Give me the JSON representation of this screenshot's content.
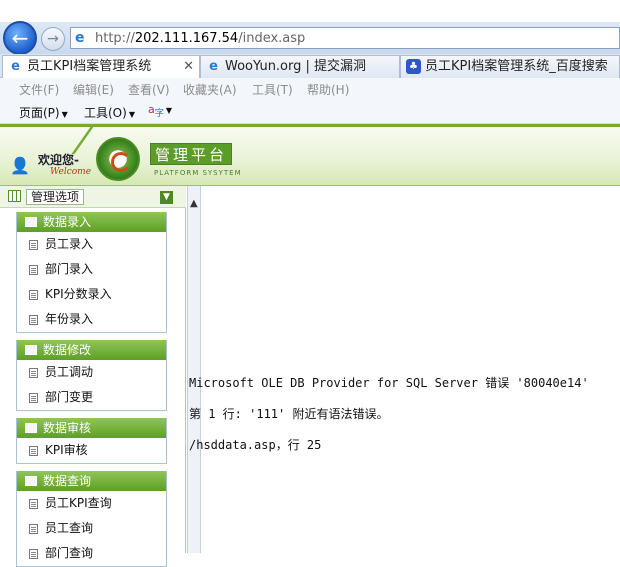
{
  "browser": {
    "url_prefix": "http://",
    "url_host": "202.111.167.54",
    "url_path": "/index.asp",
    "tabs": [
      {
        "label": "员工KPI档案管理系统",
        "active": true,
        "icon": "ie-icon"
      },
      {
        "label": "WooYun.org | 提交漏洞",
        "active": false,
        "icon": "ie-icon"
      },
      {
        "label": "员工KPI档案管理系统_百度搜索",
        "active": false,
        "icon": "baidu-paw-icon"
      }
    ],
    "menu": [
      "文件(F)",
      "编辑(E)",
      "查看(V)",
      "收藏夹(A)",
      "工具(T)",
      "帮助(H)"
    ],
    "commands": {
      "page": "页面(P)",
      "tools": "工具(O)"
    }
  },
  "banner": {
    "welcome": "欢迎您-",
    "welcome_en": "Welcome",
    "title": "管理平台",
    "title_en": "PLATFORM SYSYTEM"
  },
  "sidebar": {
    "header": "管理选项",
    "groups": [
      {
        "title": "数据录入",
        "items": [
          "员工录入",
          "部门录入",
          "KPI分数录入",
          "年份录入"
        ]
      },
      {
        "title": "数据修改",
        "items": [
          "员工调动",
          "部门变更"
        ]
      },
      {
        "title": "数据审核",
        "items": [
          "KPI审核"
        ]
      },
      {
        "title": "数据查询",
        "items": [
          "员工KPI查询",
          "员工查询",
          "部门查询"
        ]
      }
    ]
  },
  "error": {
    "line1": "Microsoft OLE DB Provider for SQL Server 错误 '80040e14'",
    "line2": "第 1 行: '111' 附近有语法错误。",
    "line3": "/hsddata.asp，行 25"
  },
  "colors": {
    "accent_green": "#5e9f24",
    "nav_blue": "#1f5fc9",
    "title_green": "#5c9d2a"
  }
}
